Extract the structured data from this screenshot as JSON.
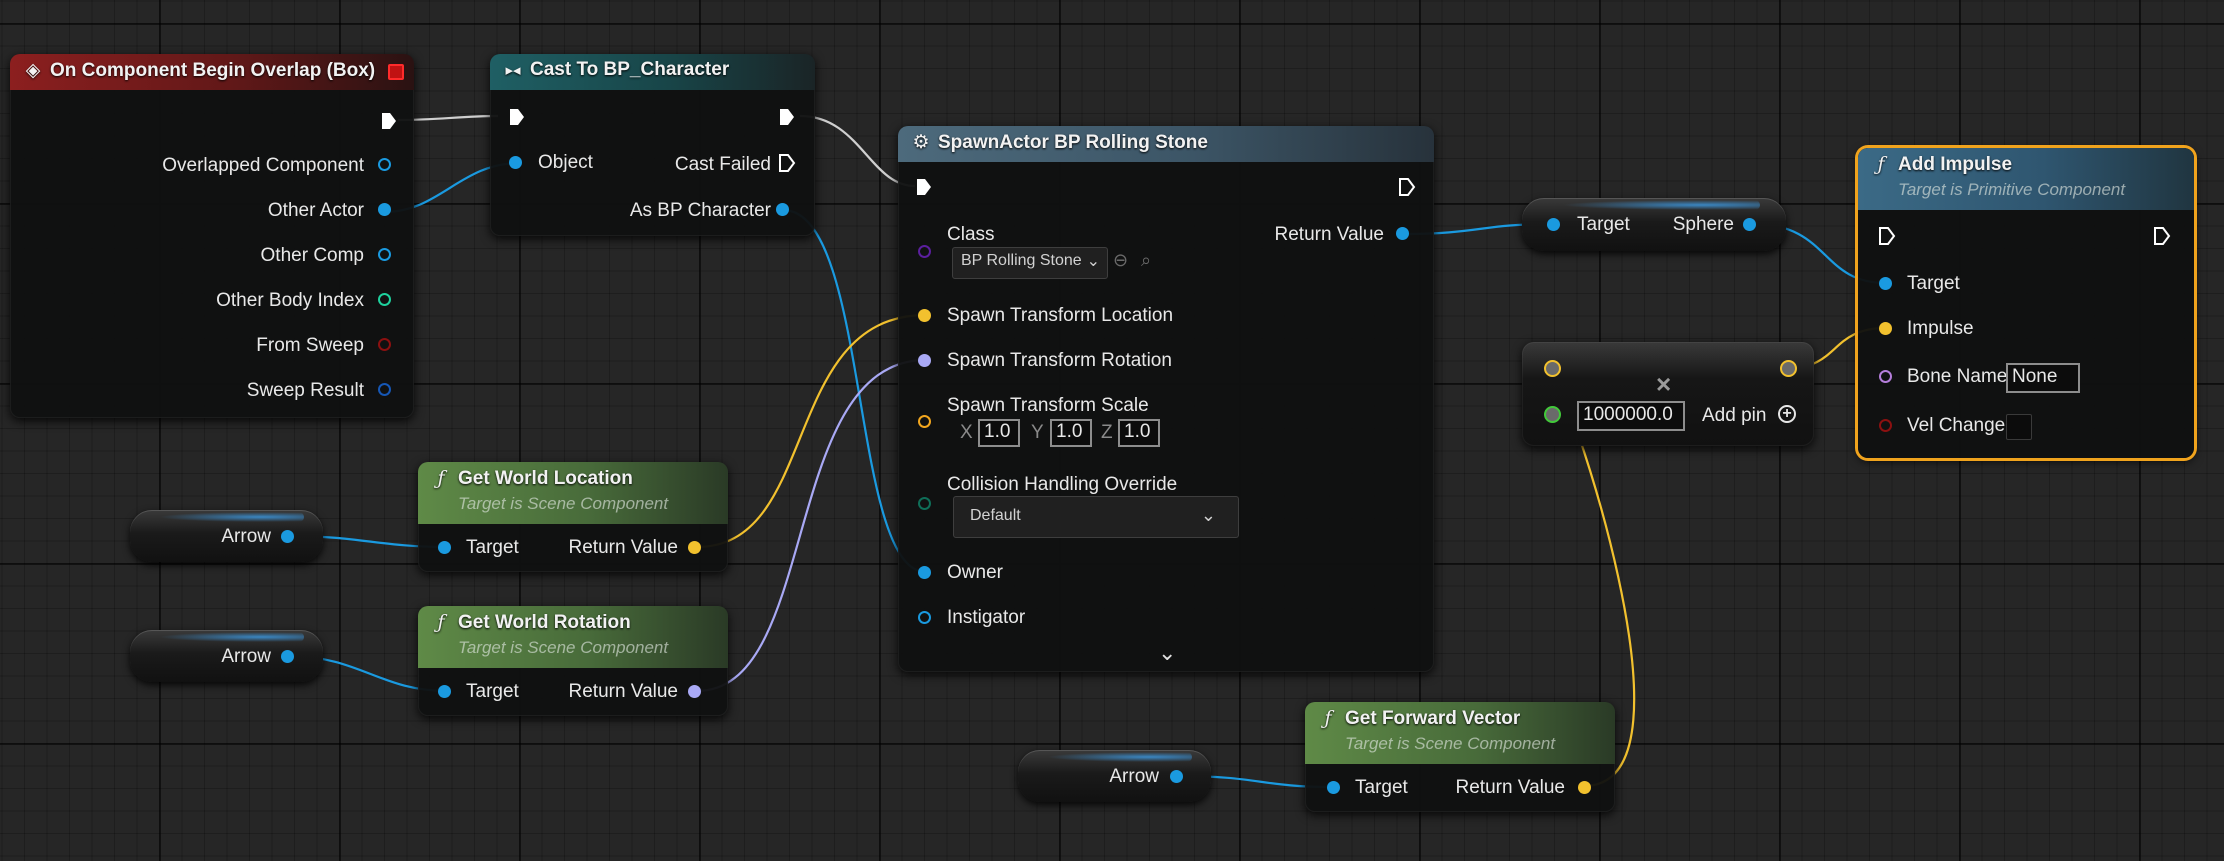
{
  "colors": {
    "object_pin": "#1a9ae0",
    "vector_pin": "#f2c12e",
    "rotator_pin": "#a9a9f5",
    "transform_pin": "#f2a61e",
    "class_pin": "#5b1f9e",
    "int_pin": "#1ed19d",
    "bool_pin": "#8c1010",
    "struct_pin": "#1657b5",
    "float_pin": "#42c93a",
    "enum_pin": "#0f6e58",
    "name_pin": "#b57edb",
    "exec_pin": "#ffffff",
    "selection": "#f0a31d"
  },
  "overlap_event": {
    "title": "On Component Begin Overlap (Box)",
    "icon": "event-diamond-icon",
    "pins": [
      "Overlapped Component",
      "Other Actor",
      "Other Comp",
      "Other Body Index",
      "From Sweep",
      "Sweep Result"
    ]
  },
  "cast_node": {
    "title": "Cast To BP_Character",
    "icon": "cast-arrows-icon",
    "object_label": "Object",
    "cast_failed_label": "Cast Failed",
    "as_label": "As BP Character"
  },
  "spawn_node": {
    "title": "SpawnActor BP Rolling Stone",
    "icon": "spawn-icon",
    "class_label": "Class",
    "class_value": "BP Rolling Stone",
    "return_label": "Return Value",
    "location_label": "Spawn Transform Location",
    "rotation_label": "Spawn Transform Rotation",
    "scale_label": "Spawn Transform Scale",
    "scale_x_label": "X",
    "scale_x": "1.0",
    "scale_y_label": "Y",
    "scale_y": "1.0",
    "scale_z_label": "Z",
    "scale_z": "1.0",
    "collision_label": "Collision Handling Override",
    "collision_value": "Default",
    "owner_label": "Owner",
    "instigator_label": "Instigator"
  },
  "get_world_location": {
    "title": "Get World Location",
    "subtitle": "Target is Scene Component",
    "target_label": "Target",
    "return_label": "Return Value"
  },
  "get_world_rotation": {
    "title": "Get World Rotation",
    "subtitle": "Target is Scene Component",
    "target_label": "Target",
    "return_label": "Return Value"
  },
  "get_forward_vector": {
    "title": "Get Forward Vector",
    "subtitle": "Target is Scene Component",
    "target_label": "Target",
    "return_label": "Return Value"
  },
  "arrow_var_1": {
    "label": "Arrow"
  },
  "arrow_var_2": {
    "label": "Arrow"
  },
  "arrow_var_3": {
    "label": "Arrow"
  },
  "sphere_getter": {
    "target_label": "Target",
    "sphere_label": "Sphere"
  },
  "multiply_node": {
    "value": "1000000.0",
    "add_pin_label": "Add pin"
  },
  "add_impulse": {
    "title": "Add Impulse",
    "subtitle": "Target is Primitive Component",
    "target_label": "Target",
    "impulse_label": "Impulse",
    "bone_name_label": "Bone Name",
    "bone_name_value": "None",
    "vel_change_label": "Vel Change"
  }
}
